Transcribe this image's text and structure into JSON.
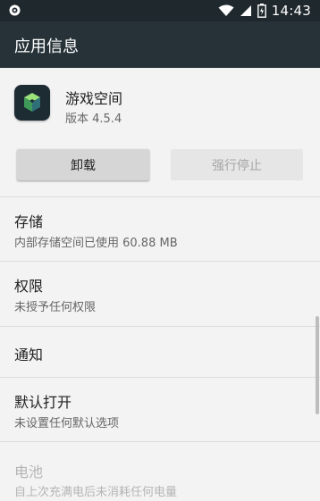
{
  "status_bar": {
    "time": "14:43"
  },
  "app_bar": {
    "title": "应用信息"
  },
  "app": {
    "name": "游戏空间",
    "version": "版本 4.5.4"
  },
  "buttons": {
    "uninstall": "卸载",
    "force_stop": "强行停止"
  },
  "settings": [
    {
      "title": "存储",
      "subtitle": "内部存储空间已使用 60.88 MB"
    },
    {
      "title": "权限",
      "subtitle": "未授予任何权限"
    },
    {
      "title": "通知",
      "subtitle": ""
    },
    {
      "title": "默认打开",
      "subtitle": "未设置任何默认选项"
    },
    {
      "title": "电池",
      "subtitle": "自上次充满电后未消耗任何电量"
    }
  ],
  "colors": {
    "status_bar": "#1f282d",
    "app_bar": "#263238",
    "background": "#f3f3f3"
  }
}
